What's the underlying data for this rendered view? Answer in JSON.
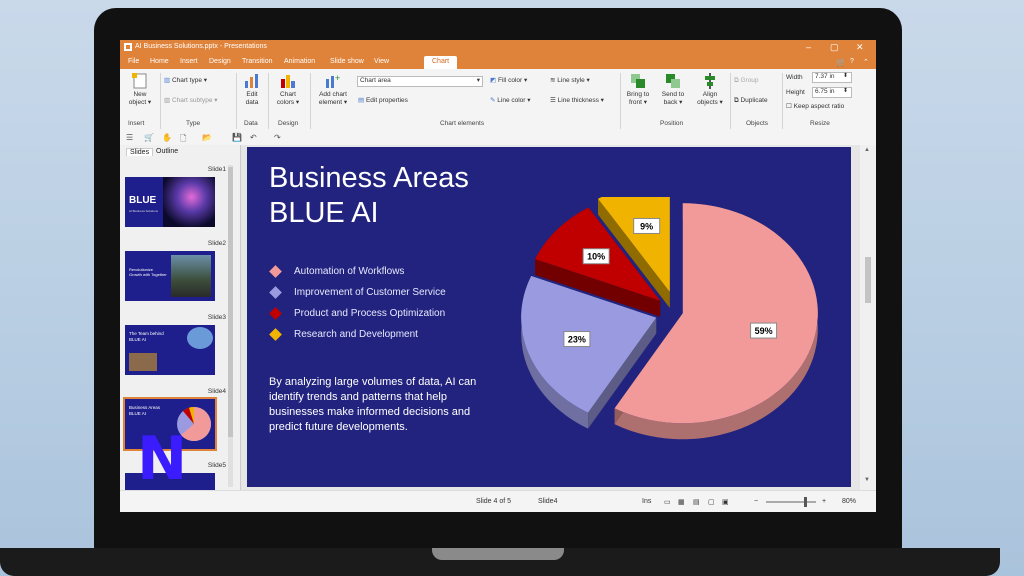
{
  "window": {
    "title": "AI Business Solutions.pptx - Presentations"
  },
  "menu": [
    "File",
    "Home",
    "Insert",
    "Design",
    "Transition",
    "Animation",
    "Slide show",
    "View",
    "Chart"
  ],
  "ribbon": {
    "new_object": "New object ▾",
    "chart_type": "Chart type ▾",
    "chart_subtype": "Chart subtype ▾",
    "edit_data": "Edit data",
    "chart_colors": "Chart colors ▾",
    "add_chart_element": "Add chart element ▾",
    "chart_area_select": "Chart area",
    "edit_properties": "Edit properties",
    "fill_color": "Fill color ▾",
    "line_color": "Line color ▾",
    "line_style": "Line style ▾",
    "line_thickness": "Line thickness ▾",
    "bring_to_front": "Bring to front ▾",
    "send_to_back": "Send to back ▾",
    "align_objects": "Align objects ▾",
    "group": "Group",
    "duplicate": "Duplicate",
    "width_label": "Width",
    "width_value": "7.37 in",
    "height_label": "Height",
    "height_value": "6.75 in",
    "keep_aspect": "Keep aspect ratio",
    "groups": [
      "Insert",
      "Type",
      "Data",
      "Design",
      "Chart elements",
      "Position",
      "Objects",
      "Resize"
    ]
  },
  "sidebar": {
    "tabs": [
      "Slides",
      "Outline"
    ],
    "slides": [
      "Slide1",
      "Slide2",
      "Slide3",
      "Slide4",
      "Slide5"
    ],
    "thumb_texts": {
      "s1_title": "BLUE",
      "s1_sub": "AI Business Solutions",
      "s2_text": "Revolutionize Growth with Together",
      "s3_text": "The Team behind BLUE AI",
      "s4_text": "Business Areas BLUE AI"
    }
  },
  "slide": {
    "title_line1": "Business Areas",
    "title_line2": "BLUE AI",
    "bullets": [
      {
        "text": "Automation of Workflows",
        "color": "#f29a9a"
      },
      {
        "text": "Improvement of Customer Service",
        "color": "#9a9ae0"
      },
      {
        "text": "Product and Process Optimization",
        "color": "#c00000"
      },
      {
        "text": "Research and Development",
        "color": "#f0b400"
      }
    ],
    "paragraph": "By analyzing large volumes of data, AI can identify trends and patterns that help businesses make informed decisions and predict future developments."
  },
  "chart_data": {
    "type": "pie",
    "categories": [
      "Automation of Workflows",
      "Improvement of Customer Service",
      "Product and Process Optimization",
      "Research and Development"
    ],
    "values": [
      59,
      23,
      10,
      9
    ],
    "labels": [
      "59%",
      "23%",
      "10%",
      "9%"
    ],
    "colors": [
      "#f29a9a",
      "#9a9ae0",
      "#c00000",
      "#f0b400"
    ],
    "style": "3d-exploded"
  },
  "status": {
    "slide_info": "Slide 4 of 5",
    "slide_name": "Slide4",
    "ins": "Ins",
    "zoom": "80%"
  }
}
